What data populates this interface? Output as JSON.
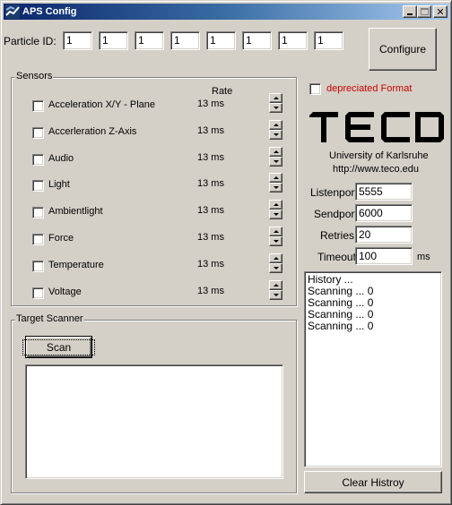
{
  "window": {
    "title": "APS Config",
    "controls": {
      "minimize": "_",
      "maximize": "□",
      "close": "✕"
    }
  },
  "particle_id": {
    "label": "Particle ID:",
    "fields": [
      "1",
      "1",
      "1",
      "1",
      "1",
      "1",
      "1",
      "1"
    ]
  },
  "configure_button": "Configure",
  "sensors": {
    "group_label": "Sensors",
    "rate_header": "Rate",
    "items": [
      {
        "name": "Acceleration X/Y - Plane",
        "rate": "13 ms",
        "checked": false
      },
      {
        "name": "Accerleration Z-Axis",
        "rate": "13 ms",
        "checked": false
      },
      {
        "name": "Audio",
        "rate": "13 ms",
        "checked": false
      },
      {
        "name": "Light",
        "rate": "13 ms",
        "checked": false
      },
      {
        "name": "Ambientlight",
        "rate": "13 ms",
        "checked": false
      },
      {
        "name": "Force",
        "rate": "13 ms",
        "checked": false
      },
      {
        "name": "Temperature",
        "rate": "13 ms",
        "checked": false
      },
      {
        "name": "Voltage",
        "rate": "13 ms",
        "checked": false
      }
    ]
  },
  "target_scanner": {
    "group_label": "Target Scanner",
    "scan_button": "Scan",
    "results": []
  },
  "depreciated_format": {
    "label": "depreciated Format",
    "checked": false,
    "color": "#cc0000"
  },
  "logo": {
    "text": "TECO",
    "university": "University of Karlsruhe",
    "url": "http://www.teco.edu"
  },
  "network": {
    "listenport": {
      "label": "Listenport",
      "value": "5555"
    },
    "sendport": {
      "label": "Sendport",
      "value": "6000"
    },
    "retries": {
      "label": "Retries",
      "value": "20"
    },
    "timeout": {
      "label": "Timeout",
      "value": "100",
      "unit": "ms"
    }
  },
  "history": {
    "lines": [
      "History ...",
      "Scanning ... 0",
      "Scanning ... 0",
      "Scanning ... 0",
      "Scanning ... 0"
    ],
    "clear_button": "Clear Histroy"
  },
  "colors": {
    "titlebar_start": "#0a246a",
    "titlebar_end": "#a6caf0",
    "face": "#d4d0c8",
    "warning_text": "#cc0000"
  }
}
